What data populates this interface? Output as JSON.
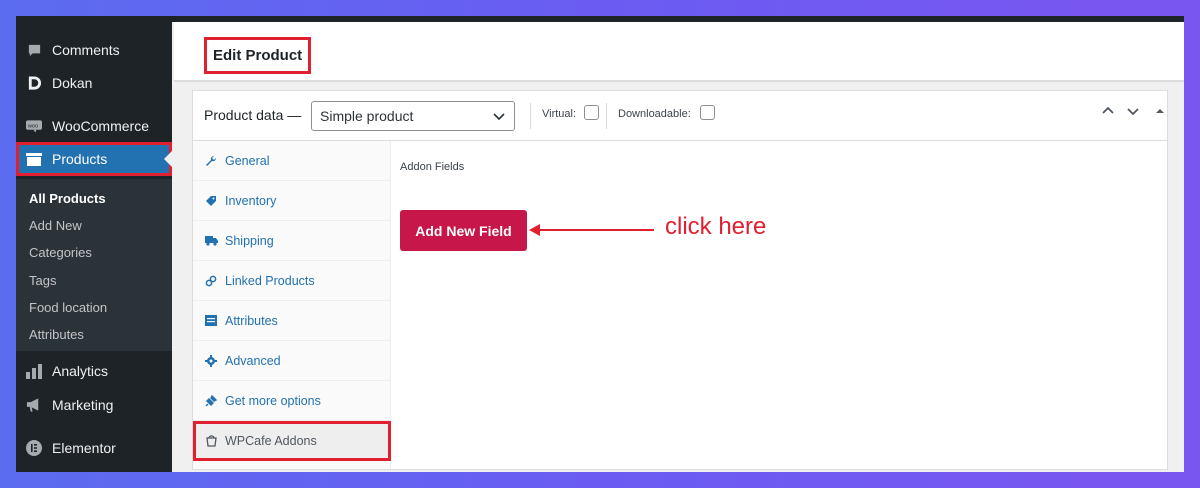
{
  "sidebar": {
    "items": [
      {
        "label": "Comments",
        "icon": "comment-icon"
      },
      {
        "label": "Dokan",
        "icon": "dokan-icon"
      },
      {
        "label": "WooCommerce",
        "icon": "woo-icon"
      },
      {
        "label": "Products",
        "icon": "products-icon"
      },
      {
        "label": "Analytics",
        "icon": "bar-chart-icon"
      },
      {
        "label": "Marketing",
        "icon": "megaphone-icon"
      },
      {
        "label": "Elementor",
        "icon": "elementor-icon"
      }
    ],
    "submenu": [
      "All Products",
      "Add New",
      "Categories",
      "Tags",
      "Food location",
      "Attributes"
    ]
  },
  "header": {
    "title": "Edit Product"
  },
  "panel": {
    "product_data_label": "Product data —",
    "product_type": "Simple product",
    "virtual_label": "Virtual:",
    "downloadable_label": "Downloadable:"
  },
  "tabs": [
    {
      "label": "General",
      "icon": "wrench-icon"
    },
    {
      "label": "Inventory",
      "icon": "tag-icon"
    },
    {
      "label": "Shipping",
      "icon": "truck-icon"
    },
    {
      "label": "Linked Products",
      "icon": "link-icon"
    },
    {
      "label": "Attributes",
      "icon": "list-icon"
    },
    {
      "label": "Advanced",
      "icon": "gear-icon"
    },
    {
      "label": "Get more options",
      "icon": "plugin-icon"
    },
    {
      "label": "WPCafe Addons",
      "icon": "cafe-icon"
    }
  ],
  "main": {
    "addon_fields_label": "Addon Fields",
    "add_button": "Add New Field",
    "annotation": "click here"
  },
  "colors": {
    "accent": "#2271b1",
    "button": "#c7164a",
    "highlight": "#e02030",
    "sidebar_bg": "#1d2327"
  }
}
